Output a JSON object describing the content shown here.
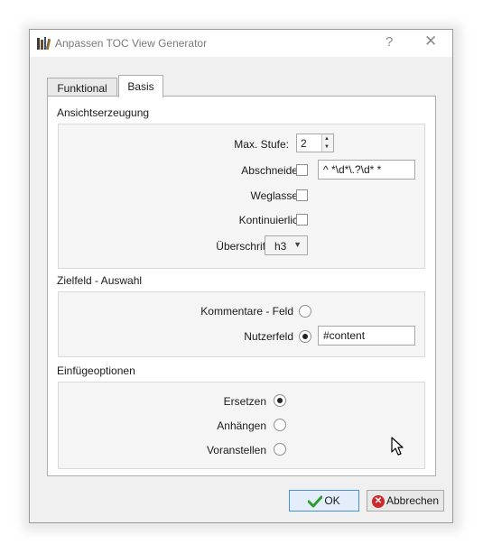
{
  "window": {
    "title": "Anpassen TOC View Generator",
    "help_label": "?",
    "close_label": "✕"
  },
  "tabs": [
    {
      "label": "Funktional",
      "active": false
    },
    {
      "label": "Basis",
      "active": true
    }
  ],
  "view_generation": {
    "section_title": "Ansichtserzeugung",
    "max_level_label": "Max. Stufe:",
    "max_level_value": "2",
    "truncate_label": "Abschneiden:",
    "truncate_checked": false,
    "truncate_pattern": "^ *\\d*\\.?\\d* *",
    "omit_label": "Weglassen:",
    "omit_checked": false,
    "continuous_label": "Kontinuierlich:",
    "continuous_checked": false,
    "headings_label": "Überschriften:",
    "headings_value": "h3"
  },
  "target_field": {
    "section_title": "Zielfeld - Auswahl",
    "comments_label": "Kommentare - Feld",
    "comments_selected": false,
    "user_field_label": "Nutzerfeld",
    "user_field_selected": true,
    "user_field_value": "#content"
  },
  "insert_options": {
    "section_title": "Einfügeoptionen",
    "replace_label": "Ersetzen",
    "replace_selected": true,
    "append_label": "Anhängen",
    "append_selected": false,
    "prepend_label": "Voranstellen",
    "prepend_selected": false
  },
  "buttons": {
    "ok_label": "OK",
    "cancel_label": "Abbrechen"
  },
  "colors": {
    "ok_icon": "#2e9d2e",
    "cancel_icon": "#cc2a2a",
    "accent_border": "#4a90d9"
  }
}
